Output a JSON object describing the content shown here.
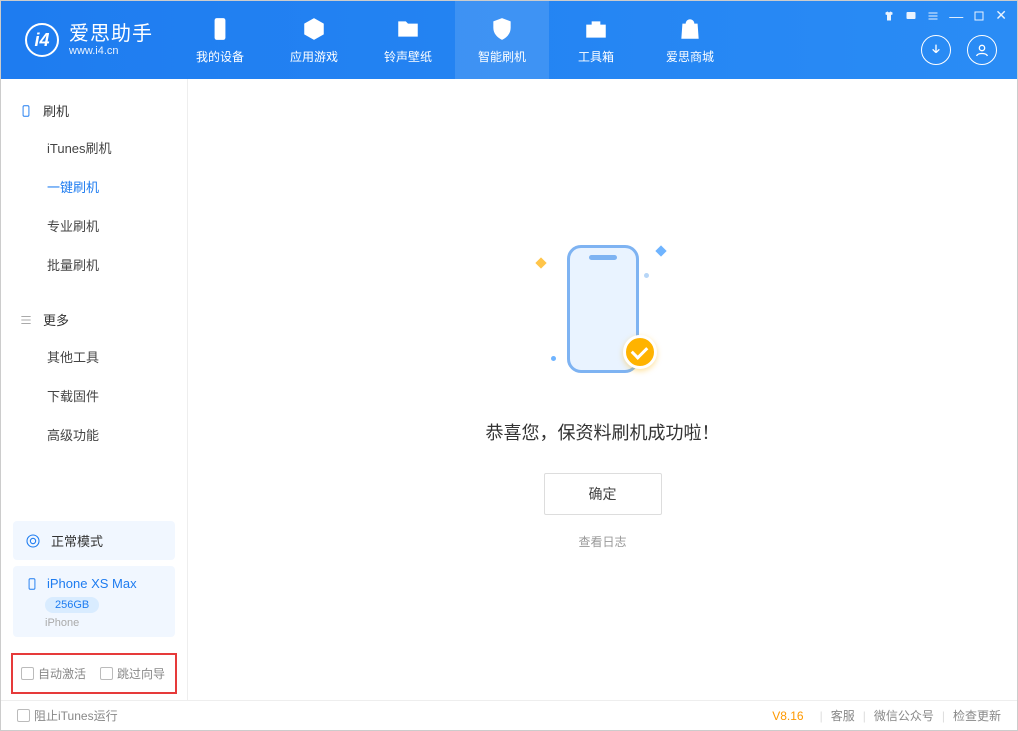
{
  "app": {
    "title": "爱思助手",
    "subtitle": "www.i4.cn"
  },
  "nav": {
    "items": [
      {
        "label": "我的设备"
      },
      {
        "label": "应用游戏"
      },
      {
        "label": "铃声壁纸"
      },
      {
        "label": "智能刷机"
      },
      {
        "label": "工具箱"
      },
      {
        "label": "爱思商城"
      }
    ]
  },
  "sidebar": {
    "section1": {
      "title": "刷机",
      "items": [
        "iTunes刷机",
        "一键刷机",
        "专业刷机",
        "批量刷机"
      ]
    },
    "section2": {
      "title": "更多",
      "items": [
        "其他工具",
        "下载固件",
        "高级功能"
      ]
    },
    "status_label": "正常模式",
    "device": {
      "name": "iPhone XS Max",
      "storage": "256GB",
      "type": "iPhone"
    },
    "check_auto_activate": "自动激活",
    "check_skip_guide": "跳过向导"
  },
  "main": {
    "success_message": "恭喜您，保资料刷机成功啦！",
    "ok_button": "确定",
    "log_link": "查看日志"
  },
  "footer": {
    "block_itunes": "阻止iTunes运行",
    "version": "V8.16",
    "links": [
      "客服",
      "微信公众号",
      "检查更新"
    ]
  }
}
